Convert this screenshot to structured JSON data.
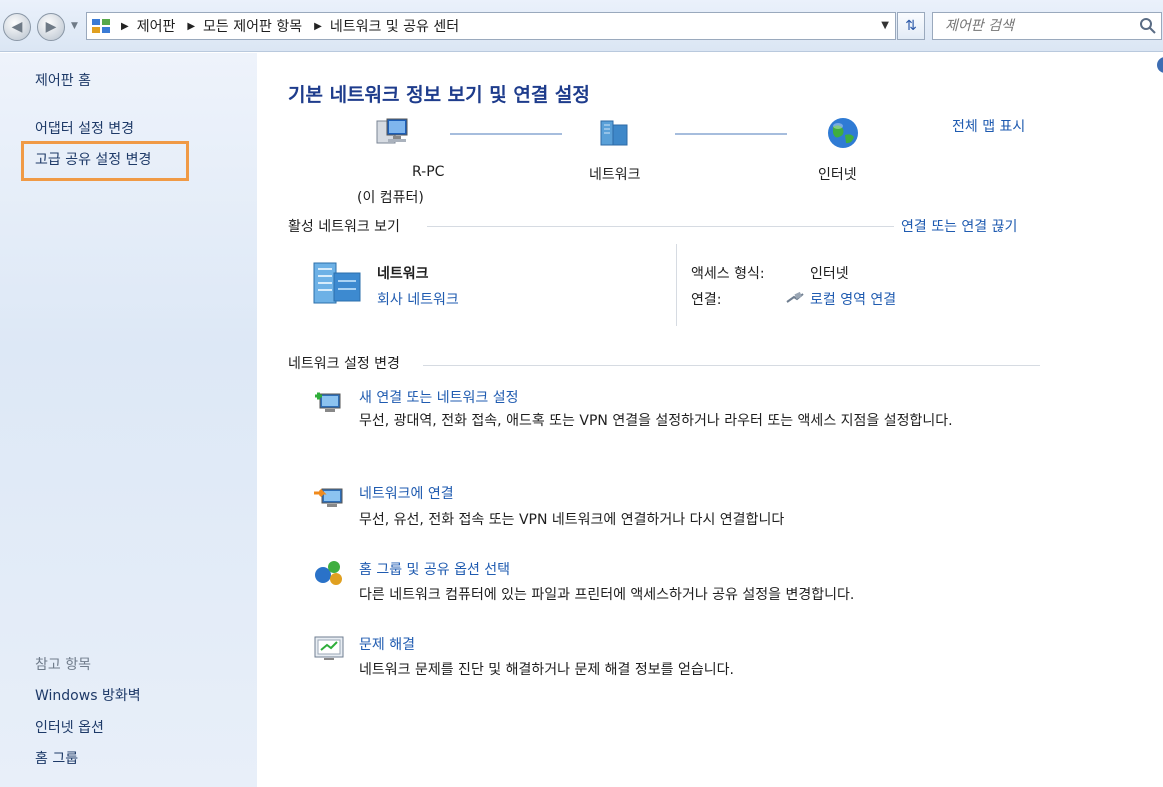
{
  "address_bar": {
    "breadcrumbs": [
      "제어판",
      "모든 제어판 항목",
      "네트워크 및 공유 센터"
    ],
    "search_placeholder": "제어판 검색"
  },
  "sidebar": {
    "home": "제어판 홈",
    "links": [
      "어댑터 설정 변경",
      "고급 공유 설정 변경"
    ],
    "see_also_title": "참고 항목",
    "see_also": [
      "Windows 방화벽",
      "인터넷 옵션",
      "홈 그룹"
    ]
  },
  "main": {
    "title": "기본 네트워크 정보 보기 및 연결 설정",
    "full_map": "전체 맵 표시",
    "map": {
      "pc_name": "R-PC",
      "pc_note": "(이 컴퓨터)",
      "network": "네트워크",
      "internet": "인터넷"
    },
    "active_networks": {
      "heading": "활성 네트워크 보기",
      "disconnect_link": "연결 또는 연결 끊기",
      "network_name": "네트워크",
      "network_type": "회사 네트워크",
      "access_label": "액세스 형식:",
      "access_value": "인터넷",
      "connections_label": "연결:",
      "connections_value": "로컬 영역 연결"
    },
    "change_settings": {
      "heading": "네트워크 설정 변경",
      "tasks": [
        {
          "title": "새 연결 또는 네트워크 설정",
          "desc": "무선, 광대역, 전화 접속, 애드혹 또는 VPN 연결을 설정하거나 라우터 또는 액세스 지점을 설정합니다."
        },
        {
          "title": "네트워크에 연결",
          "desc": "무선, 유선, 전화 접속 또는 VPN 네트워크에 연결하거나 다시 연결합니다"
        },
        {
          "title": "홈 그룹 및 공유 옵션 선택",
          "desc": "다른 네트워크 컴퓨터에 있는 파일과 프린터에 액세스하거나 공유 설정을 변경합니다."
        },
        {
          "title": "문제 해결",
          "desc": "네트워크 문제를 진단 및 해결하거나 문제 해결 정보를 얻습니다."
        }
      ]
    }
  }
}
